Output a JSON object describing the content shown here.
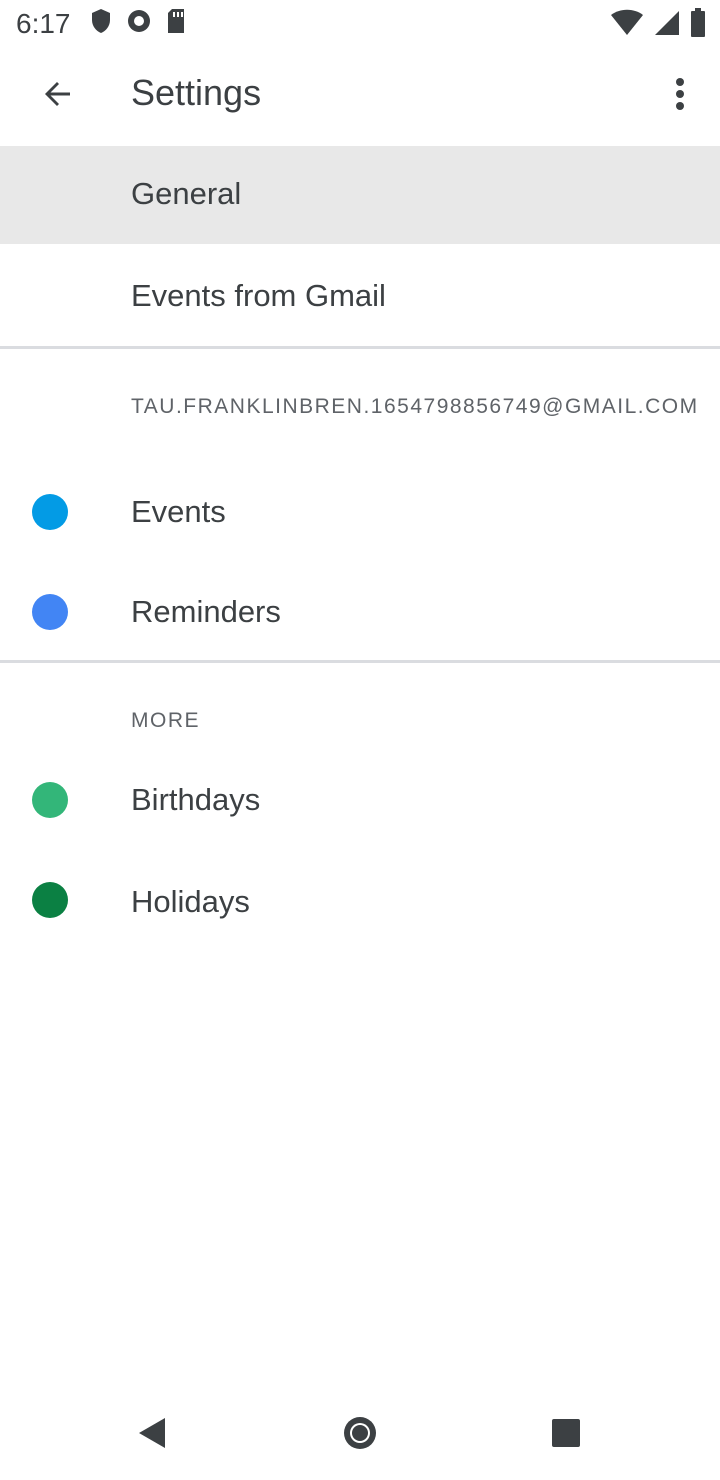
{
  "status_bar": {
    "time": "6:17",
    "left_icons": [
      "shield-icon",
      "circle-icon",
      "sd-card-icon"
    ],
    "right_icons": [
      "wifi-icon",
      "signal-icon",
      "battery-icon"
    ]
  },
  "app_bar": {
    "title": "Settings",
    "back_icon": "arrow-back-icon",
    "more_icon": "more-vert-icon"
  },
  "items": {
    "general": "General",
    "gmail": "Events from Gmail"
  },
  "account": {
    "email": "TAU.FRANKLINBREN.1654798856749@GMAIL.COM",
    "calendars": [
      {
        "label": "Events",
        "color": "#039be5"
      },
      {
        "label": "Reminders",
        "color": "#4285f4"
      }
    ]
  },
  "more": {
    "header": "MORE",
    "calendars": [
      {
        "label": "Birthdays",
        "color": "#33b679"
      },
      {
        "label": "Holidays",
        "color": "#0b8043"
      }
    ]
  },
  "nav": {
    "back_icon": "nav-back-icon",
    "home_icon": "nav-home-icon",
    "recents_icon": "nav-recents-icon"
  },
  "colors": {
    "selected_bg": "#e8e8e8",
    "divider": "#dadce0",
    "text": "#3c4043"
  }
}
